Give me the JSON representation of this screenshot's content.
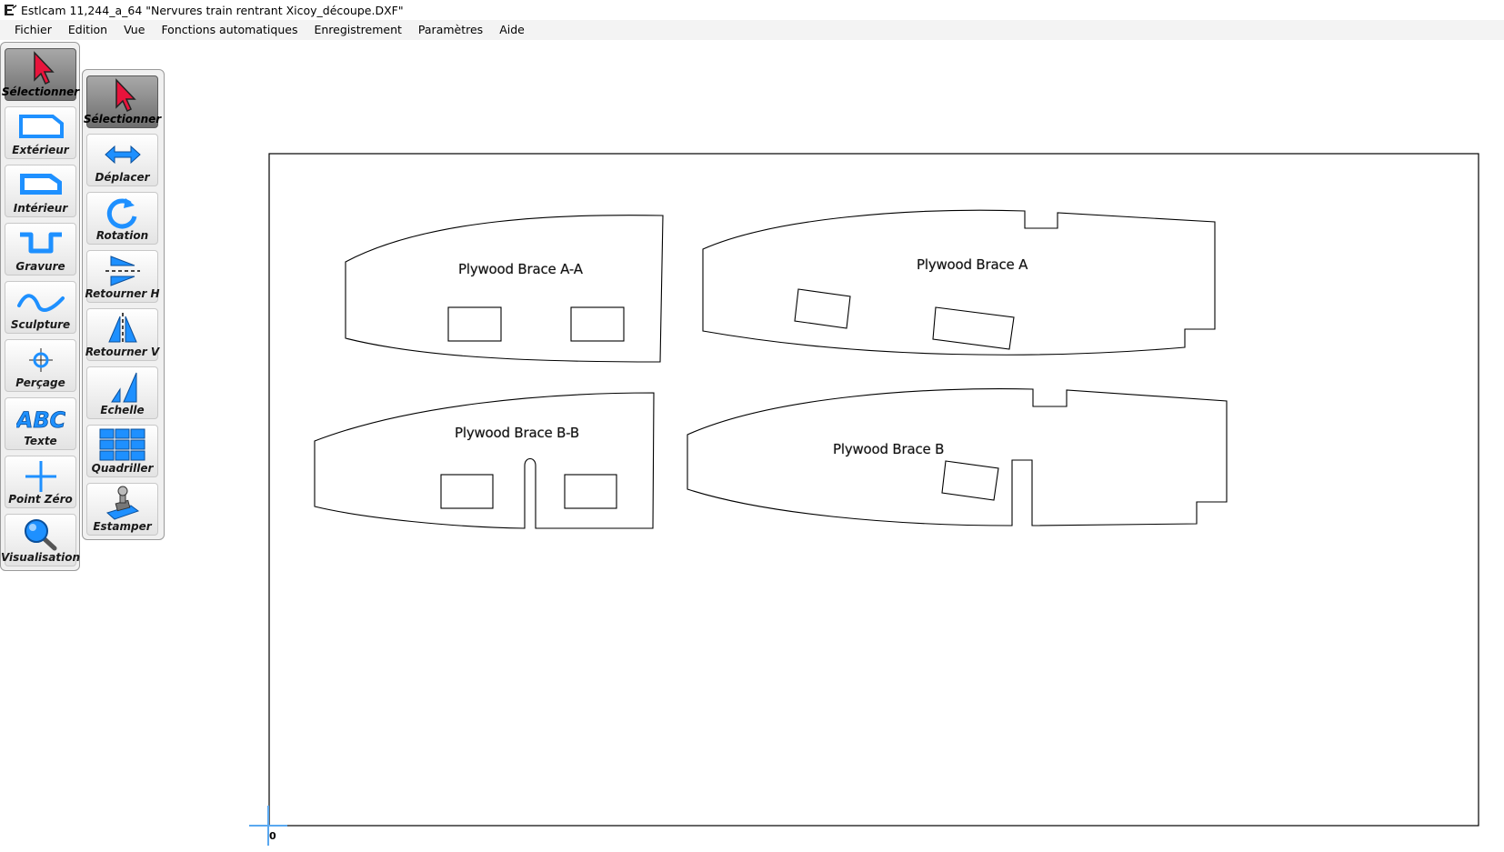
{
  "window": {
    "title": "Estlcam 11,244_a_64 \"Nervures train rentrant Xicoy_découpe.DXF\""
  },
  "menu": {
    "items": [
      "Fichier",
      "Edition",
      "Vue",
      "Fonctions automatiques",
      "Enregistrement",
      "Paramètres",
      "Aide"
    ]
  },
  "toolbar_main": {
    "items": [
      {
        "label": "Sélectionner",
        "icon": "cursor-icon",
        "active": true
      },
      {
        "label": "Extérieur",
        "icon": "outer-contour-icon"
      },
      {
        "label": "Intérieur",
        "icon": "inner-contour-icon"
      },
      {
        "label": "Gravure",
        "icon": "engrave-icon"
      },
      {
        "label": "Sculpture",
        "icon": "carve-icon"
      },
      {
        "label": "Perçage",
        "icon": "drill-icon"
      },
      {
        "label": "Texte",
        "icon": "text-icon"
      },
      {
        "label": "Point Zéro",
        "icon": "origin-point-icon"
      },
      {
        "label": "Visualisation",
        "icon": "magnifier-icon"
      }
    ]
  },
  "toolbar_sub": {
    "items": [
      {
        "label": "Sélectionner",
        "icon": "cursor-icon",
        "active": true
      },
      {
        "label": "Déplacer",
        "icon": "move-arrows-icon"
      },
      {
        "label": "Rotation",
        "icon": "rotate-icon"
      },
      {
        "label": "Retourner H",
        "icon": "flip-horizontal-icon"
      },
      {
        "label": "Retourner V",
        "icon": "flip-vertical-icon"
      },
      {
        "label": "Echelle",
        "icon": "scale-icon"
      },
      {
        "label": "Quadriller",
        "icon": "grid-icon"
      },
      {
        "label": "Estamper",
        "icon": "stamp-icon"
      }
    ]
  },
  "drawing": {
    "parts": [
      {
        "label": "Plywood Brace A-A"
      },
      {
        "label": "Plywood Brace A"
      },
      {
        "label": "Plywood Brace B-B"
      },
      {
        "label": "Plywood Brace B"
      }
    ],
    "origin_label": "0"
  },
  "colors": {
    "accent_blue": "#1e90ff",
    "cursor_red": "#e8143c",
    "stroke": "#000000"
  }
}
